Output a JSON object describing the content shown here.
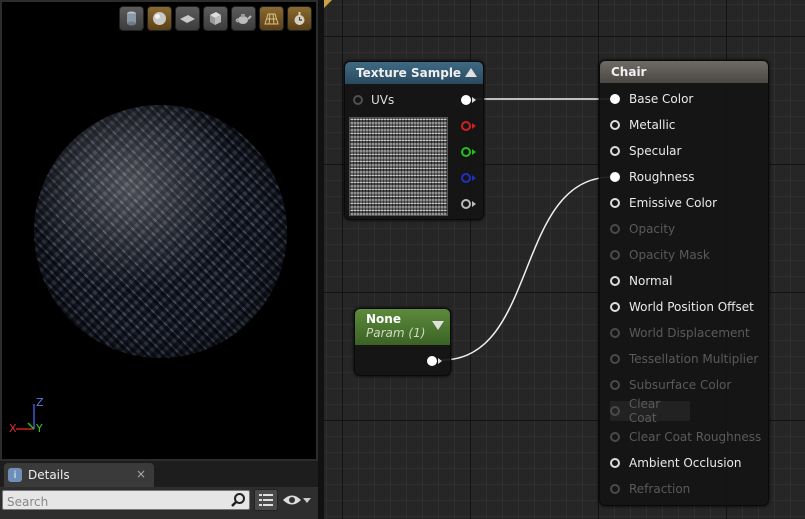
{
  "viewport": {
    "toolbar_icons": [
      "cylinder-icon",
      "sphere-icon",
      "plane-icon",
      "cube-icon",
      "teapot-icon",
      "grid-icon",
      "realtime-icon"
    ],
    "axis": {
      "z": "Z",
      "x": "X",
      "y": "Y"
    }
  },
  "details": {
    "tab_label": "Details",
    "tab_close": "×",
    "search_placeholder": "Search"
  },
  "graph": {
    "texture_node": {
      "title": "Texture Sample",
      "uvs_label": "UVs",
      "pin_colors": [
        "#ffffff",
        "#d02020",
        "#20c020",
        "#2020c0",
        "#bbbbbb"
      ]
    },
    "param_node": {
      "title": "None",
      "subtitle": "Param (1)"
    },
    "chair_node": {
      "title": "Chair",
      "pins": [
        {
          "label": "Base Color",
          "enabled": true,
          "connected": true
        },
        {
          "label": "Metallic",
          "enabled": true,
          "connected": false
        },
        {
          "label": "Specular",
          "enabled": true,
          "connected": false
        },
        {
          "label": "Roughness",
          "enabled": true,
          "connected": true
        },
        {
          "label": "Emissive Color",
          "enabled": true,
          "connected": false
        },
        {
          "label": "Opacity",
          "enabled": false,
          "connected": false
        },
        {
          "label": "Opacity Mask",
          "enabled": false,
          "connected": false
        },
        {
          "label": "Normal",
          "enabled": true,
          "connected": false
        },
        {
          "label": "World Position Offset",
          "enabled": true,
          "connected": false
        },
        {
          "label": "World Displacement",
          "enabled": false,
          "connected": false
        },
        {
          "label": "Tessellation Multiplier",
          "enabled": false,
          "connected": false
        },
        {
          "label": "Subsurface Color",
          "enabled": false,
          "connected": false
        },
        {
          "label": "Clear Coat",
          "enabled": false,
          "connected": false
        },
        {
          "label": "Clear Coat Roughness",
          "enabled": false,
          "connected": false
        },
        {
          "label": "Ambient Occlusion",
          "enabled": true,
          "connected": false
        },
        {
          "label": "Refraction",
          "enabled": false,
          "connected": false
        }
      ]
    }
  }
}
